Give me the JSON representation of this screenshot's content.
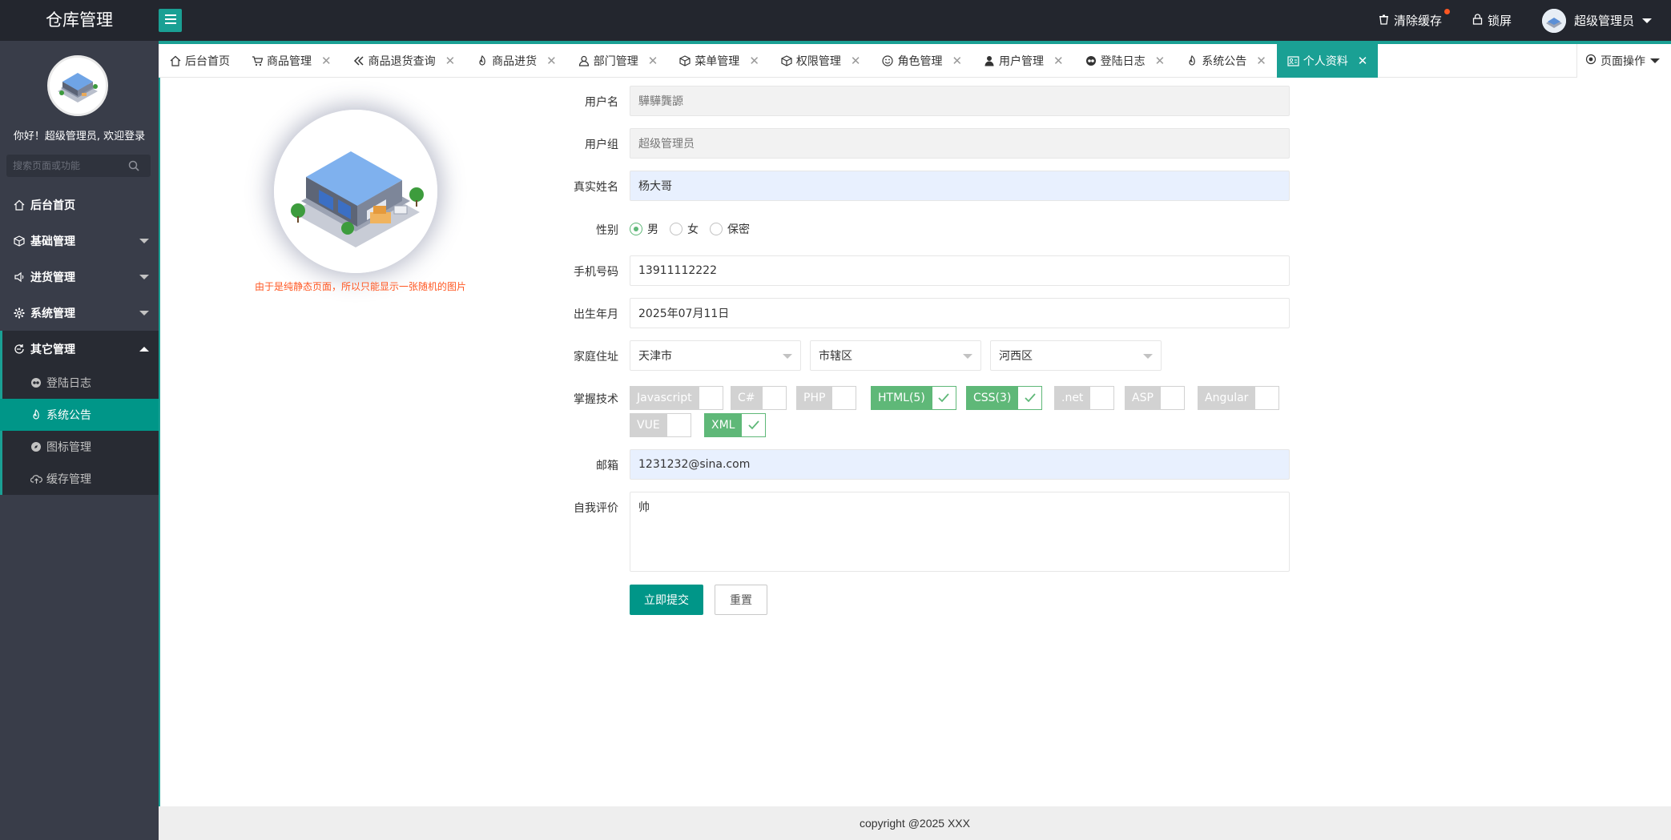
{
  "header": {
    "app_title": "仓库管理",
    "menu_icon": "hamburger-icon",
    "clear_cache": "清除缓存",
    "lock_screen": "锁屏",
    "user_name": "超级管理员",
    "accent_color": "#1aa094"
  },
  "sidebar": {
    "welcome": "你好！超级管理员, 欢迎登录",
    "search_placeholder": "搜索页面或功能",
    "items": [
      {
        "label": "后台首页",
        "icon": "home-icon"
      },
      {
        "label": "基础管理",
        "icon": "cube-icon"
      },
      {
        "label": "进货管理",
        "icon": "speaker-icon"
      },
      {
        "label": "系统管理",
        "icon": "gear-icon"
      },
      {
        "label": "其它管理",
        "icon": "refresh-icon"
      }
    ],
    "sub_items": [
      {
        "label": "登陆日志",
        "icon": "log-icon"
      },
      {
        "label": "系统公告",
        "icon": "fire-icon"
      },
      {
        "label": "图标管理",
        "icon": "compass-icon"
      },
      {
        "label": "缓存管理",
        "icon": "cloud-icon"
      }
    ]
  },
  "tabs": [
    {
      "label": "后台首页",
      "icon": "home-icon"
    },
    {
      "label": "商品管理",
      "icon": "cart-icon"
    },
    {
      "label": "商品退货查询",
      "icon": "double-left-icon"
    },
    {
      "label": "商品进货",
      "icon": "fire-icon"
    },
    {
      "label": "部门管理",
      "icon": "user-icon"
    },
    {
      "label": "菜单管理",
      "icon": "cube-icon"
    },
    {
      "label": "权限管理",
      "icon": "cube-icon"
    },
    {
      "label": "角色管理",
      "icon": "smile-icon"
    },
    {
      "label": "用户管理",
      "icon": "person-icon"
    },
    {
      "label": "登陆日志",
      "icon": "log-icon"
    },
    {
      "label": "系统公告",
      "icon": "fire-icon"
    },
    {
      "label": "个人资料",
      "icon": "profile-card-icon"
    }
  ],
  "page_op": "页面操作",
  "profile": {
    "avatar_note": "由于是纯静态页面，所以只能显示一张随机的图片"
  },
  "form": {
    "username_label": "用户名",
    "username_value": "驊驊龔謜",
    "group_label": "用户组",
    "group_value": "超级管理员",
    "realname_label": "真实姓名",
    "realname_value": "杨大哥",
    "gender_label": "性别",
    "gender_options": [
      "男",
      "女",
      "保密"
    ],
    "phone_label": "手机号码",
    "phone_value": "13911112222",
    "birth_label": "出生年月",
    "birth_value": "2025年07月11日",
    "address_label": "家庭住址",
    "province": "天津市",
    "city": "市辖区",
    "district": "河西区",
    "skills_label": "掌握技术",
    "skills": [
      {
        "label": "Javascript",
        "checked": false
      },
      {
        "label": "C#",
        "checked": false
      },
      {
        "label": "PHP",
        "checked": false
      },
      {
        "label": "HTML(5)",
        "checked": true
      },
      {
        "label": "CSS(3)",
        "checked": true
      },
      {
        "label": ".net",
        "checked": false
      },
      {
        "label": "ASP",
        "checked": false
      },
      {
        "label": "Angular",
        "checked": false
      },
      {
        "label": "VUE",
        "checked": false
      },
      {
        "label": "XML",
        "checked": true
      }
    ],
    "email_label": "邮箱",
    "email_value": "1231232@sina.com",
    "bio_label": "自我评价",
    "bio_value": "帅",
    "submit_label": "立即提交",
    "reset_label": "重置"
  },
  "footer": {
    "copyright": "copyright @2025 XXX"
  }
}
